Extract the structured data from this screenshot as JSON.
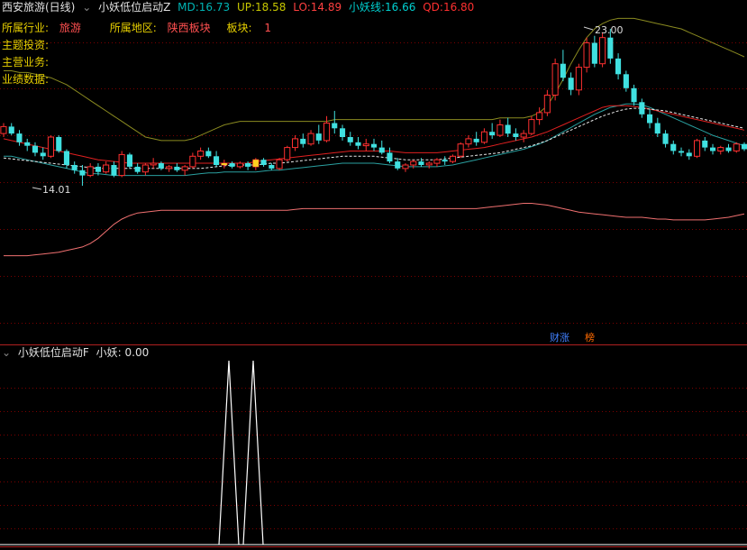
{
  "header": {
    "stock": "西安旅游(日线)",
    "indicator": "小妖低位启动Z",
    "md_label": "MD:",
    "md": "16.73",
    "up_label": "UP:",
    "up": "18.58",
    "lo_label": "LO:",
    "lo": "14.89",
    "xy_label": "小妖线:",
    "xy": "16.66",
    "qd_label": "QD:",
    "qd": "16.80",
    "colors": {
      "md": "#00b4b4",
      "up": "#c8c800",
      "lo": "#ff4040",
      "xy": "#00d0d0",
      "qd": "#ff3030"
    }
  },
  "info": {
    "industry_label": "所属行业:",
    "industry": "旅游",
    "region_label": "所属地区:",
    "region": "陕西板块",
    "block_label": "板块:",
    "block": "1",
    "theme_label": "主题投资:",
    "business_label": "主营业务:",
    "perf_label": "业绩数据:"
  },
  "annotations": {
    "high": "23.00",
    "low": "14.01"
  },
  "tags": {
    "caizhang": "财涨",
    "bang": "榜"
  },
  "sub": {
    "indicator": "小妖低位启动F",
    "value_label": "小妖:",
    "value": "0.00"
  },
  "chart_data": {
    "type": "candlestick",
    "ohlc": [
      [
        17.0,
        17.6,
        16.8,
        17.4
      ],
      [
        17.4,
        17.6,
        16.9,
        17.0
      ],
      [
        17.0,
        17.2,
        16.3,
        16.5
      ],
      [
        16.5,
        16.7,
        16.0,
        16.3
      ],
      [
        16.3,
        16.5,
        15.7,
        15.9
      ],
      [
        15.9,
        16.2,
        15.5,
        15.7
      ],
      [
        15.7,
        16.9,
        15.6,
        16.8
      ],
      [
        16.8,
        16.9,
        15.9,
        16.0
      ],
      [
        16.0,
        16.1,
        15.0,
        15.2
      ],
      [
        15.2,
        15.4,
        14.7,
        14.9
      ],
      [
        14.9,
        15.2,
        14.01,
        14.6
      ],
      [
        14.6,
        15.3,
        14.5,
        15.1
      ],
      [
        15.1,
        15.3,
        14.6,
        14.8
      ],
      [
        14.8,
        15.4,
        14.7,
        15.2
      ],
      [
        15.2,
        15.4,
        14.5,
        14.6
      ],
      [
        14.6,
        16.0,
        14.5,
        15.8
      ],
      [
        15.8,
        15.9,
        15.0,
        15.1
      ],
      [
        15.1,
        15.3,
        14.7,
        14.8
      ],
      [
        14.8,
        15.3,
        14.6,
        15.2
      ],
      [
        15.2,
        15.6,
        15.0,
        15.3
      ],
      [
        15.3,
        15.4,
        14.9,
        15.0
      ],
      [
        15.0,
        15.2,
        14.8,
        15.1
      ],
      [
        15.1,
        15.3,
        14.8,
        14.9
      ],
      [
        14.9,
        15.2,
        14.6,
        15.1
      ],
      [
        15.1,
        15.9,
        15.0,
        15.7
      ],
      [
        15.7,
        16.2,
        15.5,
        16.0
      ],
      [
        16.0,
        16.2,
        15.6,
        15.7
      ],
      [
        15.7,
        16.0,
        15.1,
        15.2
      ],
      [
        15.2,
        15.5,
        15.0,
        15.3
      ],
      [
        15.3,
        15.4,
        15.0,
        15.1
      ],
      [
        15.1,
        15.4,
        15.0,
        15.3
      ],
      [
        15.3,
        15.4,
        14.9,
        15.1
      ],
      [
        15.1,
        15.6,
        14.9,
        15.5
      ],
      [
        15.5,
        15.6,
        15.1,
        15.2
      ],
      [
        15.2,
        15.3,
        14.9,
        15.0
      ],
      [
        15.0,
        15.6,
        14.9,
        15.5
      ],
      [
        15.5,
        16.3,
        15.4,
        16.2
      ],
      [
        16.2,
        16.9,
        16.0,
        16.7
      ],
      [
        16.7,
        17.0,
        16.2,
        16.4
      ],
      [
        16.4,
        17.2,
        16.3,
        17.0
      ],
      [
        17.0,
        17.5,
        16.4,
        16.6
      ],
      [
        16.6,
        18.0,
        16.5,
        17.6
      ],
      [
        17.6,
        18.3,
        17.0,
        17.3
      ],
      [
        17.3,
        17.5,
        16.6,
        16.8
      ],
      [
        16.8,
        17.1,
        16.3,
        16.5
      ],
      [
        16.5,
        16.8,
        16.1,
        16.3
      ],
      [
        16.3,
        16.7,
        16.0,
        16.4
      ],
      [
        16.4,
        16.7,
        16.0,
        16.2
      ],
      [
        16.2,
        16.6,
        15.8,
        15.9
      ],
      [
        15.9,
        16.2,
        15.3,
        15.4
      ],
      [
        15.4,
        15.6,
        14.9,
        15.0
      ],
      [
        15.0,
        15.3,
        14.8,
        15.2
      ],
      [
        15.2,
        15.5,
        15.0,
        15.4
      ],
      [
        15.4,
        15.6,
        15.1,
        15.2
      ],
      [
        15.2,
        15.4,
        15.0,
        15.3
      ],
      [
        15.3,
        15.6,
        15.1,
        15.5
      ],
      [
        15.5,
        15.7,
        15.2,
        15.4
      ],
      [
        15.4,
        15.8,
        15.3,
        15.7
      ],
      [
        15.7,
        16.5,
        15.6,
        16.4
      ],
      [
        16.4,
        16.9,
        16.2,
        16.7
      ],
      [
        16.7,
        17.1,
        16.3,
        16.5
      ],
      [
        16.5,
        17.3,
        16.4,
        17.1
      ],
      [
        17.1,
        17.6,
        16.7,
        16.9
      ],
      [
        16.9,
        17.8,
        16.8,
        17.5
      ],
      [
        17.5,
        17.9,
        16.8,
        17.0
      ],
      [
        17.0,
        17.3,
        16.6,
        16.8
      ],
      [
        16.8,
        17.2,
        16.5,
        17.0
      ],
      [
        17.0,
        18.0,
        16.9,
        17.8
      ],
      [
        17.8,
        18.5,
        17.5,
        18.2
      ],
      [
        18.2,
        19.5,
        18.0,
        19.2
      ],
      [
        19.2,
        21.3,
        18.9,
        21.0
      ],
      [
        21.0,
        21.8,
        20.0,
        20.2
      ],
      [
        20.2,
        20.5,
        19.2,
        19.5
      ],
      [
        19.5,
        21.0,
        19.2,
        20.8
      ],
      [
        20.8,
        22.5,
        20.5,
        22.2
      ],
      [
        22.2,
        22.6,
        20.8,
        21.0
      ],
      [
        21.0,
        22.8,
        20.8,
        22.5
      ],
      [
        22.5,
        23.0,
        21.0,
        21.3
      ],
      [
        21.3,
        21.6,
        20.1,
        20.4
      ],
      [
        20.4,
        20.6,
        19.4,
        19.6
      ],
      [
        19.6,
        19.8,
        18.6,
        18.8
      ],
      [
        18.8,
        19.0,
        17.9,
        18.1
      ],
      [
        18.1,
        18.4,
        17.3,
        17.6
      ],
      [
        17.6,
        17.9,
        16.8,
        17.0
      ],
      [
        17.0,
        17.2,
        16.2,
        16.4
      ],
      [
        16.4,
        16.6,
        15.8,
        16.0
      ],
      [
        16.0,
        16.2,
        15.7,
        15.9
      ],
      [
        15.9,
        16.1,
        15.5,
        15.7
      ],
      [
        15.7,
        16.7,
        15.6,
        16.6
      ],
      [
        16.6,
        16.8,
        16.0,
        16.2
      ],
      [
        16.2,
        16.4,
        15.8,
        16.0
      ],
      [
        16.0,
        16.3,
        15.8,
        16.2
      ],
      [
        16.2,
        16.4,
        15.9,
        16.0
      ],
      [
        16.0,
        16.5,
        15.9,
        16.4
      ],
      [
        16.4,
        16.5,
        16.0,
        16.1
      ]
    ],
    "price_range": [
      14.0,
      23.2
    ],
    "series": {
      "up": [
        20.6,
        20.6,
        20.5,
        20.5,
        20.4,
        20.3,
        20.2,
        20.0,
        19.8,
        19.5,
        19.2,
        18.9,
        18.6,
        18.3,
        18.0,
        17.7,
        17.4,
        17.1,
        16.8,
        16.7,
        16.6,
        16.6,
        16.6,
        16.6,
        16.7,
        16.9,
        17.1,
        17.3,
        17.5,
        17.6,
        17.7,
        17.7,
        17.7,
        17.7,
        17.7,
        17.7,
        17.7,
        17.7,
        17.7,
        17.7,
        17.7,
        17.7,
        17.8,
        17.8,
        17.8,
        17.8,
        17.8,
        17.8,
        17.8,
        17.8,
        17.8,
        17.8,
        17.8,
        17.8,
        17.8,
        17.8,
        17.8,
        17.8,
        17.8,
        17.8,
        17.8,
        17.8,
        17.8,
        17.9,
        17.9,
        17.9,
        17.9,
        18.0,
        18.2,
        18.6,
        19.3,
        20.1,
        21.0,
        21.8,
        22.5,
        23.0,
        23.3,
        23.5,
        23.6,
        23.6,
        23.6,
        23.5,
        23.4,
        23.3,
        23.2,
        23.1,
        23.0,
        22.8,
        22.6,
        22.4,
        22.2,
        22.0,
        21.8,
        21.6,
        21.4
      ],
      "md": [
        16.7,
        16.6,
        16.5,
        16.4,
        16.3,
        16.2,
        16.1,
        16.0,
        15.9,
        15.8,
        15.7,
        15.6,
        15.5,
        15.45,
        15.4,
        15.35,
        15.3,
        15.3,
        15.3,
        15.3,
        15.3,
        15.3,
        15.3,
        15.3,
        15.3,
        15.3,
        15.3,
        15.3,
        15.3,
        15.3,
        15.3,
        15.3,
        15.4,
        15.45,
        15.5,
        15.55,
        15.6,
        15.65,
        15.7,
        15.75,
        15.8,
        15.85,
        15.9,
        15.95,
        16.0,
        16.0,
        16.0,
        16.0,
        16.0,
        16.0,
        15.95,
        15.9,
        15.9,
        15.9,
        15.9,
        15.9,
        15.95,
        16.0,
        16.05,
        16.1,
        16.15,
        16.2,
        16.3,
        16.4,
        16.5,
        16.6,
        16.7,
        16.8,
        16.95,
        17.1,
        17.3,
        17.5,
        17.7,
        17.9,
        18.1,
        18.3,
        18.5,
        18.6,
        18.6,
        18.6,
        18.55,
        18.5,
        18.4,
        18.3,
        18.2,
        18.1,
        18.0,
        17.9,
        17.8,
        17.7,
        17.6,
        17.5,
        17.4,
        17.3,
        17.2
      ],
      "lo": [
        13.0,
        13.0,
        13.0,
        13.0,
        13.05,
        13.1,
        13.15,
        13.2,
        13.3,
        13.4,
        13.5,
        13.7,
        14.0,
        14.4,
        14.8,
        15.1,
        15.3,
        15.45,
        15.5,
        15.55,
        15.6,
        15.6,
        15.6,
        15.6,
        15.6,
        15.6,
        15.6,
        15.6,
        15.6,
        15.6,
        15.6,
        15.6,
        15.6,
        15.6,
        15.6,
        15.6,
        15.6,
        15.65,
        15.7,
        15.7,
        15.7,
        15.7,
        15.7,
        15.7,
        15.7,
        15.7,
        15.7,
        15.7,
        15.7,
        15.7,
        15.7,
        15.7,
        15.7,
        15.7,
        15.7,
        15.7,
        15.7,
        15.7,
        15.7,
        15.7,
        15.7,
        15.75,
        15.8,
        15.85,
        15.9,
        15.95,
        16.0,
        16.0,
        15.95,
        15.9,
        15.8,
        15.7,
        15.6,
        15.5,
        15.45,
        15.4,
        15.35,
        15.3,
        15.25,
        15.2,
        15.2,
        15.2,
        15.15,
        15.1,
        15.1,
        15.05,
        15.05,
        15.05,
        15.05,
        15.05,
        15.1,
        15.15,
        15.2,
        15.3,
        15.4
      ],
      "xy": [
        16.3,
        16.3,
        16.2,
        16.1,
        16.0,
        15.9,
        15.8,
        15.7,
        15.6,
        15.5,
        15.4,
        15.3,
        15.3,
        15.25,
        15.2,
        15.2,
        15.2,
        15.2,
        15.2,
        15.2,
        15.2,
        15.2,
        15.2,
        15.2,
        15.25,
        15.3,
        15.35,
        15.35,
        15.4,
        15.4,
        15.4,
        15.4,
        15.4,
        15.45,
        15.5,
        15.5,
        15.55,
        15.6,
        15.65,
        15.7,
        15.75,
        15.8,
        15.85,
        15.9,
        15.9,
        15.9,
        15.9,
        15.9,
        15.85,
        15.8,
        15.75,
        15.7,
        15.7,
        15.7,
        15.7,
        15.7,
        15.75,
        15.8,
        15.9,
        16.0,
        16.1,
        16.2,
        16.3,
        16.4,
        16.5,
        16.6,
        16.7,
        16.85,
        17.0,
        17.2,
        17.45,
        17.7,
        17.95,
        18.2,
        18.45,
        18.7,
        18.9,
        19.1,
        19.2,
        19.3,
        19.3,
        19.25,
        19.1,
        18.9,
        18.7,
        18.5,
        18.3,
        18.1,
        17.9,
        17.7,
        17.5,
        17.35,
        17.2,
        17.05,
        16.9
      ],
      "md2": [
        15.6,
        15.55,
        15.5,
        15.45,
        15.4,
        15.35,
        15.3,
        15.25,
        15.2,
        15.15,
        15.1,
        15.05,
        15.0,
        15.0,
        15.0,
        15.0,
        15.0,
        15.0,
        15.0,
        15.0,
        15.0,
        15.0,
        15.0,
        15.0,
        15.0,
        15.0,
        15.05,
        15.1,
        15.15,
        15.2,
        15.2,
        15.2,
        15.2,
        15.25,
        15.3,
        15.3,
        15.35,
        15.4,
        15.45,
        15.5,
        15.55,
        15.6,
        15.65,
        15.7,
        15.7,
        15.7,
        15.7,
        15.7,
        15.65,
        15.6,
        15.55,
        15.5,
        15.5,
        15.5,
        15.5,
        15.5,
        15.55,
        15.6,
        15.65,
        15.7,
        15.75,
        15.8,
        15.85,
        15.9,
        16.0,
        16.1,
        16.2,
        16.3,
        16.45,
        16.6,
        16.8,
        17.0,
        17.2,
        17.4,
        17.6,
        17.8,
        18.0,
        18.15,
        18.3,
        18.4,
        18.45,
        18.45,
        18.4,
        18.35,
        18.3,
        18.2,
        18.1,
        18.0,
        17.9,
        17.8,
        17.7,
        17.6,
        17.5,
        17.4,
        17.3
      ],
      "sub_signal": [
        [
          250,
          405
        ],
        [
          282,
          405
        ]
      ]
    }
  }
}
